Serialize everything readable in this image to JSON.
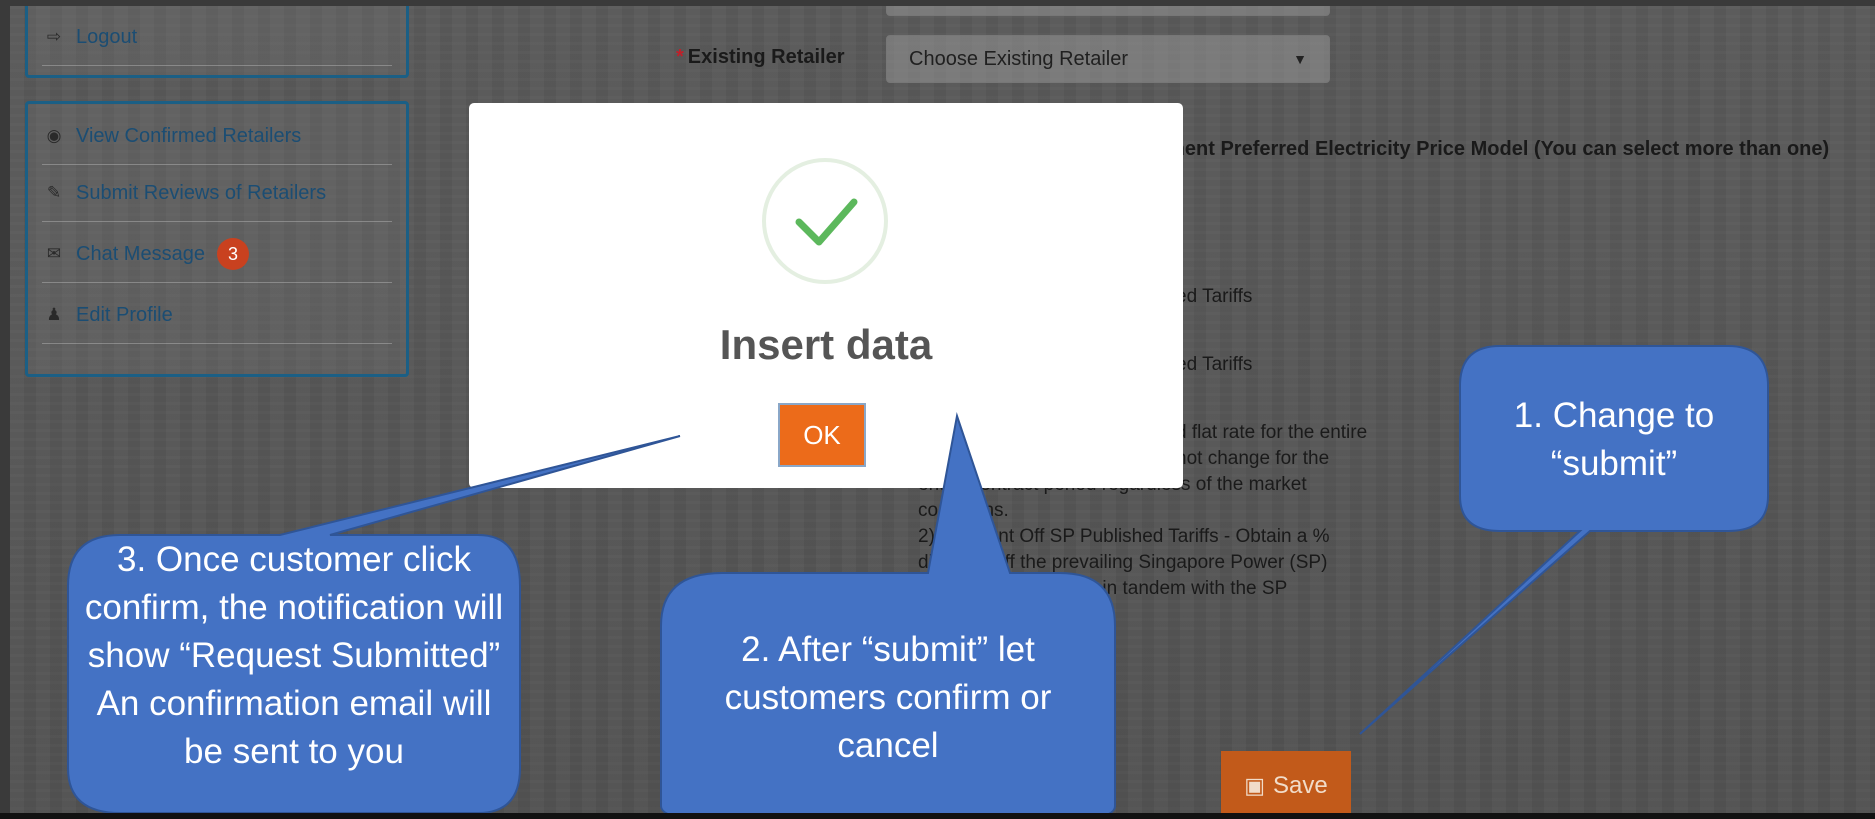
{
  "sidebar": {
    "top_item": "Logout",
    "items": [
      {
        "label": "View Confirmed Retailers",
        "icon": "eye-icon"
      },
      {
        "label": "Submit Reviews of Retailers",
        "icon": "pencil-icon"
      },
      {
        "label": "Chat Message",
        "icon": "chat-icon",
        "badge": "3"
      },
      {
        "label": "Edit Profile",
        "icon": "user-icon"
      }
    ]
  },
  "form": {
    "required_mark": "*",
    "existing_retailer_label": "Existing Retailer",
    "existing_retailer_value": "Choose Existing Retailer",
    "price_model_heading": "ement Preferred Electricity Price Model (You can select more than one)",
    "option_fragments": [
      ")",
      ")",
      "ed Tariffs",
      "ed Tariffs"
    ],
    "description_lines": [
      "d flat rate for the entire",
      "not change for the",
      "entire contract period regardless of the market",
      "conditions.",
      "2) Discount Off SP Published Tariffs - Obtain a %",
      "discount off the prevailing Singapore Power (SP)",
      "tariff, which will move in tandem with the SP"
    ],
    "save_label": "Save"
  },
  "modal": {
    "title": "Insert data",
    "ok_label": "OK",
    "accent": "#5cb85c"
  },
  "callouts": {
    "one": "1. Change to “submit”",
    "two": "2. After “submit” let customers confirm or cancel",
    "three": "3. Once customer click confirm, the notification will show “Request Submitted” An confirmation email will be sent to you"
  },
  "colors": {
    "callout_fill": "#4472c4",
    "callout_stroke": "#2f5597",
    "ok_button": "#ec6b1a",
    "save_button": "#c25a1a"
  }
}
